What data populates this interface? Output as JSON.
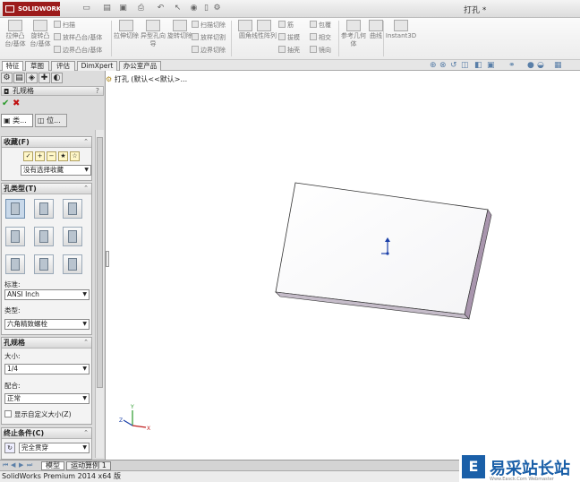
{
  "app": {
    "logo_text": "SOLIDWORKS",
    "document_title": "打孔 *"
  },
  "ribbon": {
    "features_large": [
      {
        "id": "extrude-boss",
        "label": "拉伸凸台/基体"
      },
      {
        "id": "revolve-boss",
        "label": "旋转凸台/基体"
      },
      {
        "id": "extrude-cut",
        "label": "拉伸切除"
      },
      {
        "id": "hole-wizard",
        "label": "异型孔向导"
      },
      {
        "id": "revolve-cut",
        "label": "旋转切除"
      },
      {
        "id": "fillet",
        "label": "圆角"
      },
      {
        "id": "linear-pattern",
        "label": "线性阵列"
      },
      {
        "id": "reference-geometry",
        "label": "参考几何体"
      },
      {
        "id": "curves",
        "label": "曲线"
      },
      {
        "id": "instant3d",
        "label": "Instant3D"
      }
    ],
    "features_small": [
      {
        "id": "sweep",
        "label": "扫描"
      },
      {
        "id": "loft",
        "label": "放样凸台/基体"
      },
      {
        "id": "boundary",
        "label": "边界凸台/基体"
      },
      {
        "id": "swept-cut",
        "label": "扫描切除"
      },
      {
        "id": "lofted-cut",
        "label": "放样切割"
      },
      {
        "id": "boundary-cut",
        "label": "边界切除"
      },
      {
        "id": "rib",
        "label": "筋"
      },
      {
        "id": "draft",
        "label": "拔模"
      },
      {
        "id": "shell",
        "label": "抽壳"
      },
      {
        "id": "wrap",
        "label": "包覆"
      },
      {
        "id": "intersect",
        "label": "相交"
      },
      {
        "id": "mirror",
        "label": "镜向"
      }
    ]
  },
  "cm_tabs": [
    "特征",
    "草图",
    "评估",
    "DimXpert",
    "办公室产品"
  ],
  "feature_tree": {
    "root": "打孔 (默认<<默认>..."
  },
  "property_manager": {
    "title": "孔规格",
    "help": "?",
    "subtabs": [
      "类...",
      "位..."
    ],
    "favorites": {
      "heading": "收藏(F)",
      "select_value": "没有选择收藏"
    },
    "hole_type": {
      "heading": "孔类型(T)",
      "standard_label": "标准:",
      "standard_value": "ANSI Inch",
      "type_label": "类型:",
      "type_value": "六角精致螺栓"
    },
    "hole_spec": {
      "heading": "孔规格",
      "size_label": "大小:",
      "size_value": "1/4",
      "fit_label": "配合:",
      "fit_value": "正常",
      "custom_size_label": "显示自定义大小(Z)"
    },
    "end_condition": {
      "heading": "终止条件(C)",
      "value": "完全贯穿"
    }
  },
  "model_tabs": [
    "模型",
    "运动算例 1"
  ],
  "status_bar": {
    "text": "SolidWorks Premium 2014 x64 版"
  },
  "watermark": {
    "logo": "E",
    "text": "易采站长站",
    "sub": "Www.Easck.Com Webmaster"
  },
  "colors": {
    "brand": "#9c1b1b",
    "accent": "#1a5fa8"
  }
}
